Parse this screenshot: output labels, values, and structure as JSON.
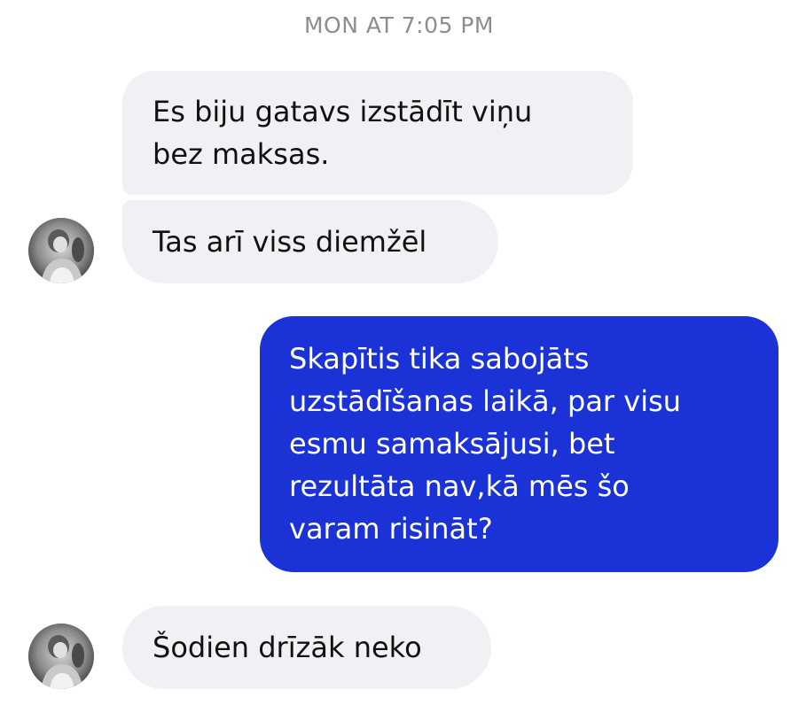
{
  "conversation": {
    "timestamp": "MON AT 7:05 PM",
    "messages": [
      {
        "sender": "contact",
        "text": "Es biju gatavs izstādīt viņu\nbez maksas."
      },
      {
        "sender": "contact",
        "text": "Tas arī viss diemžēl"
      },
      {
        "sender": "me",
        "text": "Skapītis tika sabojāts\nuzstādīšanas laikā, par visu\nesmu samaksājusi, bet\nrezultāta nav,kā mēs šo\nvaram risināt?"
      },
      {
        "sender": "contact",
        "text": "Šodien drīzāk neko"
      }
    ]
  },
  "colors": {
    "incoming_bubble": "#f0f1f4",
    "outgoing_bubble": "#1b33d6",
    "timestamp_text": "#8a8d91"
  },
  "icons": {
    "avatar": "contact-avatar-photo"
  }
}
